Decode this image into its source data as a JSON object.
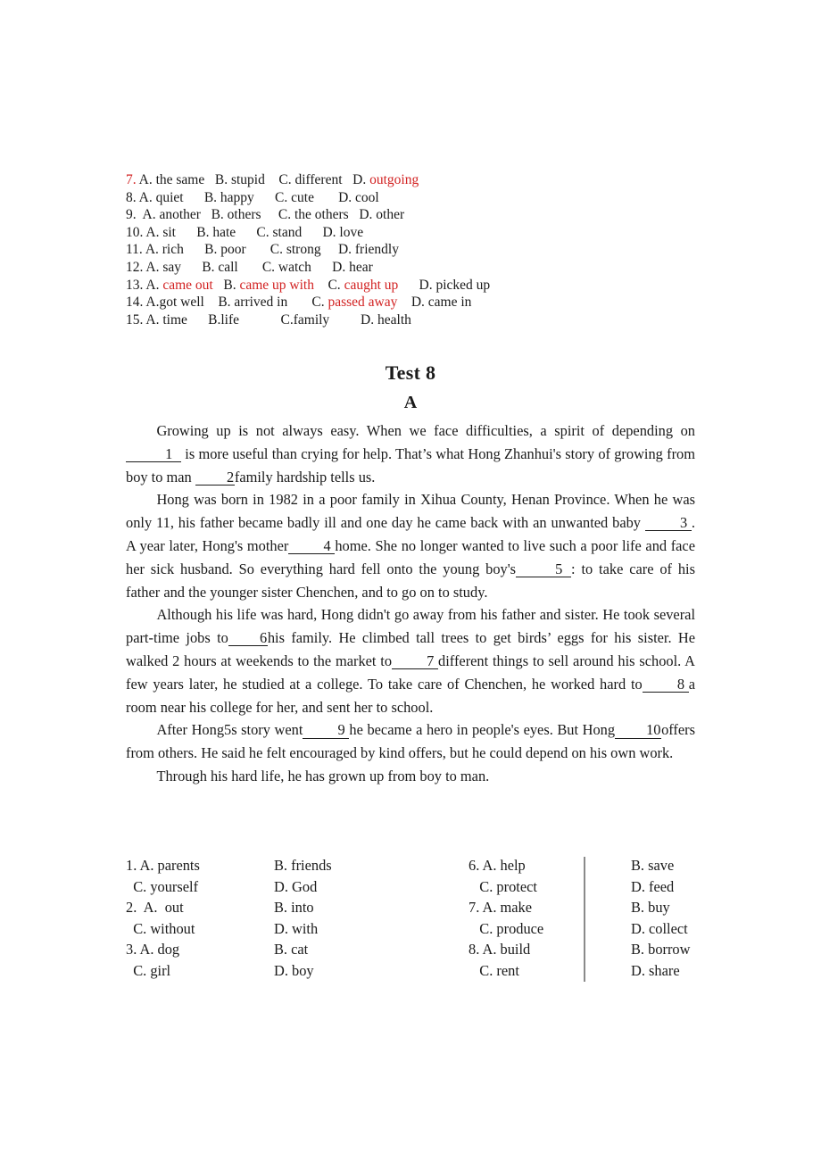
{
  "document": {
    "title": "Test 8",
    "section": "A",
    "accent_red": "#d22222",
    "text_color": "#1a1a1a"
  },
  "top_options": {
    "lines": [
      {
        "number": "7.",
        "number_red": true,
        "segments": [
          {
            "text": "7.",
            "red": true
          },
          {
            "text": " A. the same   B. stupid    C. different   D. ",
            "red": false
          },
          {
            "text": "outgoing",
            "red": true
          }
        ]
      },
      {
        "number": "8.",
        "number_red": false,
        "segments": [
          {
            "text": "8. A. quiet      B. happy      C. cute       D. cool",
            "red": false
          }
        ]
      },
      {
        "number": "9.",
        "number_red": false,
        "segments": [
          {
            "text": "9.  A. another   B. others     C. the others   D. other",
            "red": false
          }
        ]
      },
      {
        "number": "10.",
        "number_red": false,
        "segments": [
          {
            "text": "10. A. sit      B. hate      C. stand      D. love",
            "red": false
          }
        ]
      },
      {
        "number": "11.",
        "number_red": false,
        "segments": [
          {
            "text": "11. A. rich      B. poor       C. strong     D. friendly",
            "red": false
          }
        ]
      },
      {
        "number": "12.",
        "number_red": false,
        "segments": [
          {
            "text": "12. A. say      B. call       C. watch      D. hear",
            "red": false
          }
        ]
      },
      {
        "number": "13.",
        "number_red": false,
        "segments": [
          {
            "text": "13. A. ",
            "red": false
          },
          {
            "text": "came out",
            "red": true
          },
          {
            "text": "   B. ",
            "red": false
          },
          {
            "text": "came up with",
            "red": true
          },
          {
            "text": "    C. ",
            "red": false
          },
          {
            "text": "caught up",
            "red": true
          },
          {
            "text": "      D. picked up",
            "red": false
          }
        ]
      },
      {
        "number": "14.",
        "number_red": false,
        "segments": [
          {
            "text": "14. A.got well    B. arrived in       C. ",
            "red": false
          },
          {
            "text": "passed away",
            "red": true
          },
          {
            "text": "    D. came in",
            "red": false
          }
        ]
      },
      {
        "number": "15.",
        "number_red": false,
        "segments": [
          {
            "text": "15. A. time      B.life            C.family         D. health",
            "red": false
          }
        ]
      }
    ]
  },
  "passage": {
    "paragraphs": [
      {
        "id": "p1",
        "parts": [
          {
            "type": "text",
            "value": "Growing up is not always easy. When we face difficulties, a spirit of depending on "
          },
          {
            "type": "blank",
            "value": "1",
            "width": "wide"
          },
          {
            "type": "text",
            "value": " is more useful than crying for help. That’s what Hong Zhanhui's story of growing from boy to man "
          },
          {
            "type": "blank",
            "value": "2",
            "width": "nar"
          },
          {
            "type": "text",
            "value": "family hardship tells us."
          }
        ]
      },
      {
        "id": "p2",
        "parts": [
          {
            "type": "text",
            "value": "Hong was born in 1982 in a poor family in Xihua County, Henan Province. When he was only 11, his father became badly ill and one day he came back with an unwanted baby "
          },
          {
            "type": "blank",
            "value": "3",
            "width": "med"
          },
          {
            "type": "text",
            "value": ". A year later, Hong's mother"
          },
          {
            "type": "blank",
            "value": "4",
            "width": "med"
          },
          {
            "type": "text",
            "value": "home. She no longer wanted to live such a poor life and face her sick husband. So everything hard fell onto the young boy's"
          },
          {
            "type": "blank",
            "value": "5",
            "width": "wide"
          },
          {
            "type": "text",
            "value": ": to take care of his father and the younger sister Chenchen, and to go on to study."
          }
        ]
      },
      {
        "id": "p3",
        "parts": [
          {
            "type": "text",
            "value": "Although his life was hard, Hong didn't go away from his father and sister. He took several part-time jobs to"
          },
          {
            "type": "blank",
            "value": "6",
            "width": "nar"
          },
          {
            "type": "text",
            "value": "his family. He climbed tall trees to get birds’ eggs for his sister. He walked 2 hours at weekends to the market to"
          },
          {
            "type": "blank",
            "value": "7",
            "width": "med"
          },
          {
            "type": "text",
            "value": "different things to sell around his school. A few years later, he studied at a college. To take care of Chenchen, he worked hard to"
          },
          {
            "type": "blank",
            "value": "8",
            "width": "med"
          },
          {
            "type": "text",
            "value": "a room near his college for her, and sent her to school."
          }
        ]
      },
      {
        "id": "p4",
        "parts": [
          {
            "type": "text",
            "value": "After Hong5s story went"
          },
          {
            "type": "blank",
            "value": "9",
            "width": "med"
          },
          {
            "type": "text",
            "value": "he became a hero in people's eyes. But Hong"
          },
          {
            "type": "blank",
            "value": "10",
            "width": "med"
          },
          {
            "type": "text",
            "value": "offers from others. He said he felt encouraged by kind offers, but he could depend on his own work."
          }
        ]
      },
      {
        "id": "p5",
        "parts": [
          {
            "type": "text",
            "value": "Through his hard life, he has grown up from boy to man."
          }
        ]
      }
    ]
  },
  "answers": {
    "left_column": [
      {
        "number": "1.",
        "row1": {
          "a": "1. A. parents",
          "b": "B. friends"
        },
        "row2": {
          "a": "  C. yourself",
          "b": "D. God"
        }
      },
      {
        "number": "2.",
        "row1": {
          "a": "2.  A.  out",
          "b": "B. into"
        },
        "row2": {
          "a": "  C. without",
          "b": "D. with"
        }
      },
      {
        "number": "3.",
        "row1": {
          "a": "3. A. dog",
          "b": "B. cat"
        },
        "row2": {
          "a": "  C. girl",
          "b": "D. boy"
        }
      }
    ],
    "right_column": [
      {
        "number": "6.",
        "row1": {
          "a": "6. A. help",
          "b": "B. save"
        },
        "row2": {
          "a": "   C. protect",
          "b": "D. feed"
        }
      },
      {
        "number": "7.",
        "row1": {
          "a": "7. A. make",
          "b": "B. buy"
        },
        "row2": {
          "a": "   C. produce",
          "b": "D. collect"
        }
      },
      {
        "number": "8.",
        "row1": {
          "a": "8. A. build",
          "b": "B. borrow"
        },
        "row2": {
          "a": "   C. rent",
          "b": "D. share"
        }
      }
    ]
  }
}
